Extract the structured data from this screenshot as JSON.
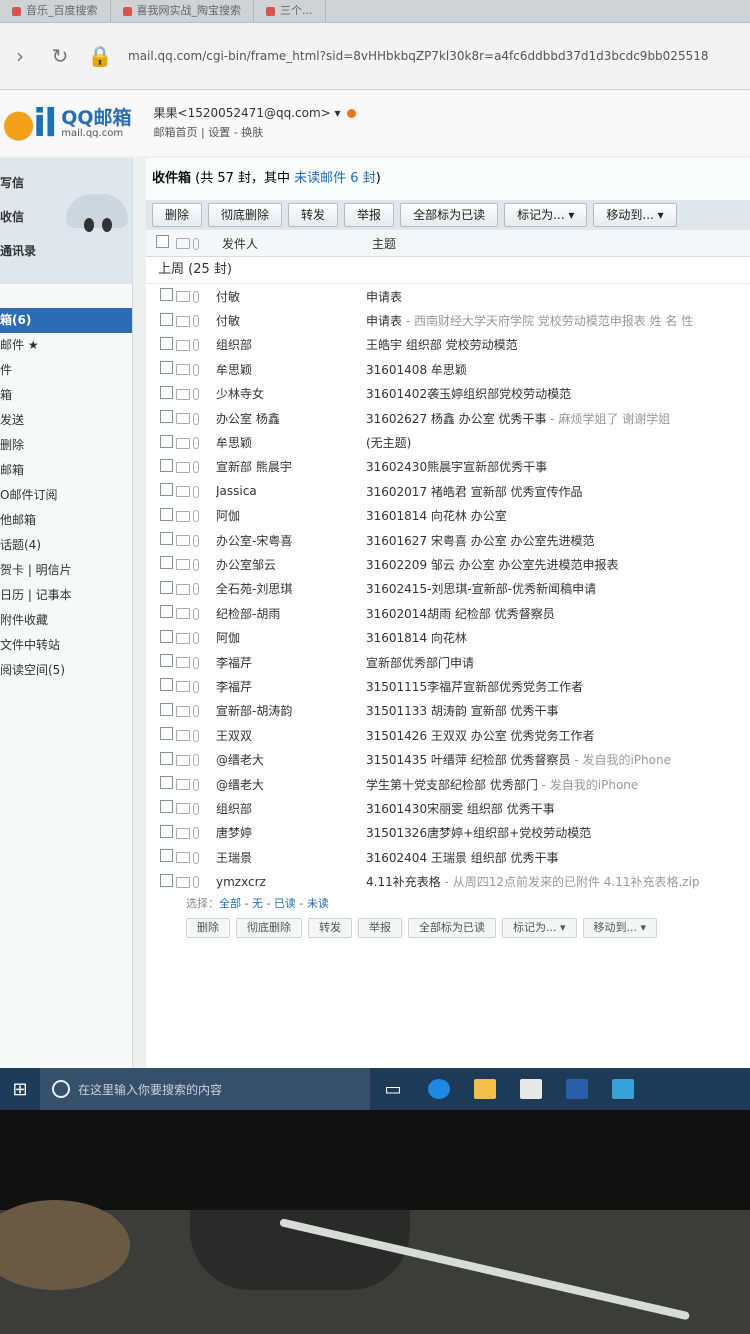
{
  "browser": {
    "tabs": [
      {
        "label": "音乐_百度搜索"
      },
      {
        "label": "喜我网实战_陶宝搜索"
      },
      {
        "label": "三个..."
      }
    ],
    "url": "mail.qq.com/cgi-bin/frame_html?sid=8vHHbkbqZP7kl30k8r=a4fc6ddbbd37d1d3bcdc9bb025518"
  },
  "header": {
    "logo_mark": "il",
    "logo_name": "QQ邮箱",
    "logo_domain": "mail.qq.com",
    "user": "果果<1520052471@qq.com> ▾",
    "links": "邮箱首页 | 设置 - 换肤"
  },
  "sidebar": {
    "top_items": [
      "写信",
      "收信",
      "通讯录"
    ],
    "folders": [
      {
        "label": "箱(6)",
        "active": true
      },
      {
        "label": "邮件 ★"
      },
      {
        "label": "件"
      },
      {
        "label": "箱"
      },
      {
        "label": "发送"
      },
      {
        "label": "删除"
      },
      {
        "label": "邮箱"
      },
      {
        "label": "O邮件订阅"
      },
      {
        "label": "他邮箱"
      },
      {
        "label": "话题(4)"
      },
      {
        "label": "贺卡 | 明信片"
      },
      {
        "label": "日历 | 记事本"
      },
      {
        "label": "附件收藏"
      },
      {
        "label": "文件中转站"
      },
      {
        "label": "阅读空间(5)"
      }
    ]
  },
  "main": {
    "title_bold": "收件箱",
    "title_rest": " (共 57 封，其中 ",
    "title_unread": "未读邮件 6 封",
    "title_end": ")",
    "toolbar": [
      "删除",
      "彻底删除",
      "转发",
      "举报",
      "全部标为已读",
      "标记为... ▾",
      "移动到... ▾"
    ],
    "col_from": "发件人",
    "col_subject": "主题",
    "group": "上周 (25 封)",
    "rows": [
      {
        "from": "付敏",
        "subject": "申请表",
        "preview": ""
      },
      {
        "from": "付敏",
        "subject": "申请表",
        "preview": " - 西南财经大学天府学院 党校劳动模范申报表 姓 名 性"
      },
      {
        "from": "组织部",
        "subject": "王皓宇 组织部 党校劳动模范",
        "preview": ""
      },
      {
        "from": "牟思颖",
        "subject": "31601408 牟思颖",
        "preview": ""
      },
      {
        "from": "少林寺女",
        "subject": "31601402袭玉婷组织部党校劳动模范",
        "preview": ""
      },
      {
        "from": "办公室  杨鑫",
        "subject": "31602627 杨鑫 办公室 优秀干事",
        "preview": " - 麻烦学姐了 谢谢学姐"
      },
      {
        "from": "牟思颖",
        "subject": "(无主题)",
        "preview": ""
      },
      {
        "from": "宣新部 熊晨宇",
        "subject": "31602430熊晨宇宣新部优秀干事",
        "preview": ""
      },
      {
        "from": "Jassica",
        "subject": "31602017 褚皓君 宣新部 优秀宣传作品",
        "preview": ""
      },
      {
        "from": "阿伽",
        "subject": "31601814 向花林        办公室",
        "preview": ""
      },
      {
        "from": "办公室-宋粤喜",
        "subject": "31601627 宋粤喜  办公室 办公室先进模范",
        "preview": ""
      },
      {
        "from": "办公室邹云",
        "subject": "31602209 邹云 办公室 办公室先进模范申报表",
        "preview": ""
      },
      {
        "from": "全石苑-刘思琪",
        "subject": "31602415-刘思琪-宣新部-优秀新闻稿申请",
        "preview": ""
      },
      {
        "from": "纪检部-胡雨",
        "subject": "31602014胡雨 纪检部 优秀督察员",
        "preview": ""
      },
      {
        "from": "阿伽",
        "subject": "31601814 向花林",
        "preview": ""
      },
      {
        "from": "李福芹",
        "subject": "宣新部优秀部门申请",
        "preview": ""
      },
      {
        "from": "李福芹",
        "subject": "31501115李福芹宣新部优秀党务工作者",
        "preview": ""
      },
      {
        "from": "宣新部-胡涛韵",
        "subject": "31501133 胡涛韵 宣新部 优秀干事",
        "preview": ""
      },
      {
        "from": "王双双",
        "subject": "31501426 王双双 办公室 优秀党务工作者",
        "preview": ""
      },
      {
        "from": "@缙老大",
        "subject": "31501435   叶缙萍   纪检部   优秀督察员",
        "preview": " - 发自我的iPhone"
      },
      {
        "from": "@缙老大",
        "subject": "学生第十党支部纪检部  优秀部门",
        "preview": " - 发自我的iPhone"
      },
      {
        "from": "组织部",
        "subject": "31601430宋丽雯 组织部 优秀干事",
        "preview": ""
      },
      {
        "from": "唐梦婷",
        "subject": "31501326唐梦婷+组织部+党校劳动模范",
        "preview": ""
      },
      {
        "from": "王瑞景",
        "subject": "31602404 王瑞景 组织部 优秀干事",
        "preview": ""
      },
      {
        "from": "ymzxcrz",
        "subject": "4.11补充表格",
        "preview": " - 从周四12点前发来的已附件 4.11补充表格.zip"
      }
    ],
    "select_label": "选择：",
    "select_opts": "全部 - 无 - 已读 - 未读",
    "toolbar_bottom": [
      "删除",
      "彻底删除",
      "转发",
      "举报",
      "全部标为已读",
      "标记为... ▾",
      "移动到... ▾"
    ]
  },
  "taskbar": {
    "search_placeholder": "在这里输入你要搜索的内容"
  }
}
